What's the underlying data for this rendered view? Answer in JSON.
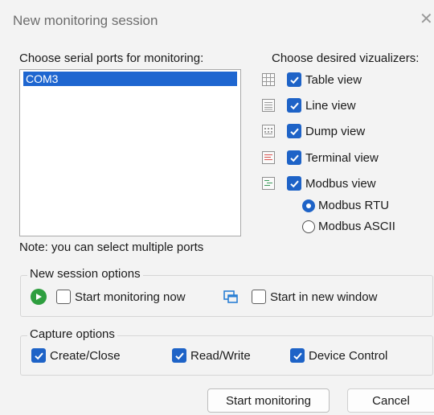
{
  "window": {
    "title": "New monitoring session",
    "close_glyph": "✕"
  },
  "ports": {
    "label": "Choose serial ports for monitoring:",
    "items": [
      "COM3"
    ],
    "note": "Note: you can select multiple ports"
  },
  "visualizers": {
    "label": "Choose desired vizualizers:",
    "items": [
      {
        "label": "Table view",
        "icon": "table-view-icon",
        "checked": true
      },
      {
        "label": "Line view",
        "icon": "line-view-icon",
        "checked": true
      },
      {
        "label": "Dump view",
        "icon": "dump-view-icon",
        "checked": true
      },
      {
        "label": "Terminal view",
        "icon": "terminal-view-icon",
        "checked": true
      },
      {
        "label": "Modbus view",
        "icon": "modbus-view-icon",
        "checked": true
      }
    ],
    "modbus_modes": [
      {
        "label": "Modbus RTU",
        "selected": true
      },
      {
        "label": "Modbus ASCII",
        "selected": false
      }
    ]
  },
  "session_options": {
    "title": "New session options",
    "start_now": {
      "label": "Start monitoring now",
      "checked": false,
      "icon": "play-icon"
    },
    "new_window": {
      "label": "Start in new window",
      "checked": false,
      "icon": "new-window-icon"
    }
  },
  "capture_options": {
    "title": "Capture options",
    "items": [
      {
        "label": "Create/Close",
        "checked": true
      },
      {
        "label": "Read/Write",
        "checked": true
      },
      {
        "label": "Device Control",
        "checked": true
      }
    ]
  },
  "buttons": {
    "start": "Start monitoring",
    "cancel": "Cancel"
  },
  "colors": {
    "accent": "#1e63c7",
    "selection": "#1e66d0",
    "play": "#2e9e3f"
  }
}
